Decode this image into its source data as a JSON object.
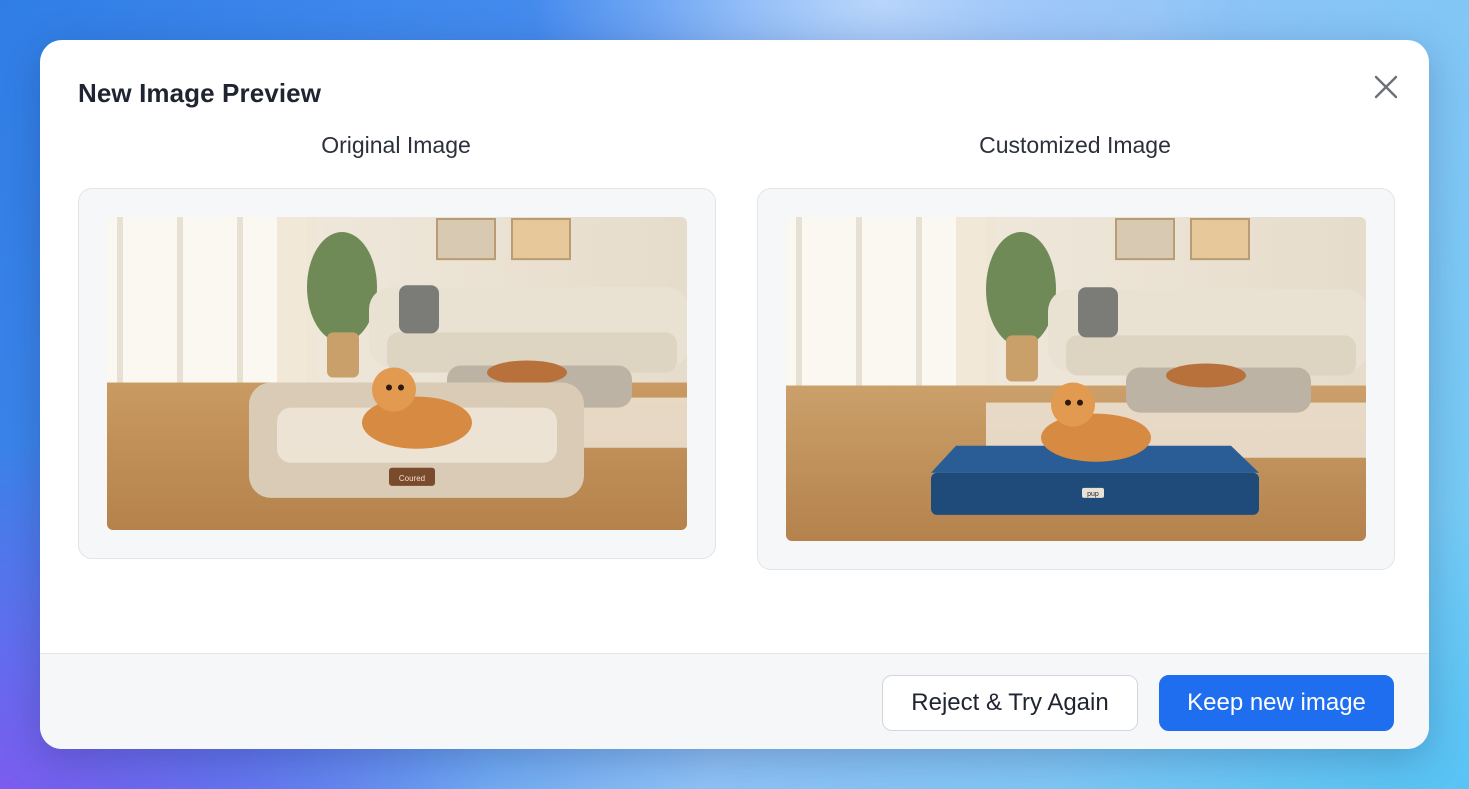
{
  "dialog": {
    "title": "New Image Preview",
    "close_icon": "close-icon"
  },
  "panels": {
    "original": {
      "label": "Original Image",
      "bed_label": "Coured"
    },
    "customized": {
      "label": "Customized Image",
      "bed_label": "pup"
    }
  },
  "footer": {
    "reject_label": "Reject & Try Again",
    "keep_label": "Keep new image"
  },
  "colors": {
    "primary": "#1f6ef0",
    "original_bed": "#d9cbb6",
    "customized_bed": "#1f4b7a"
  }
}
